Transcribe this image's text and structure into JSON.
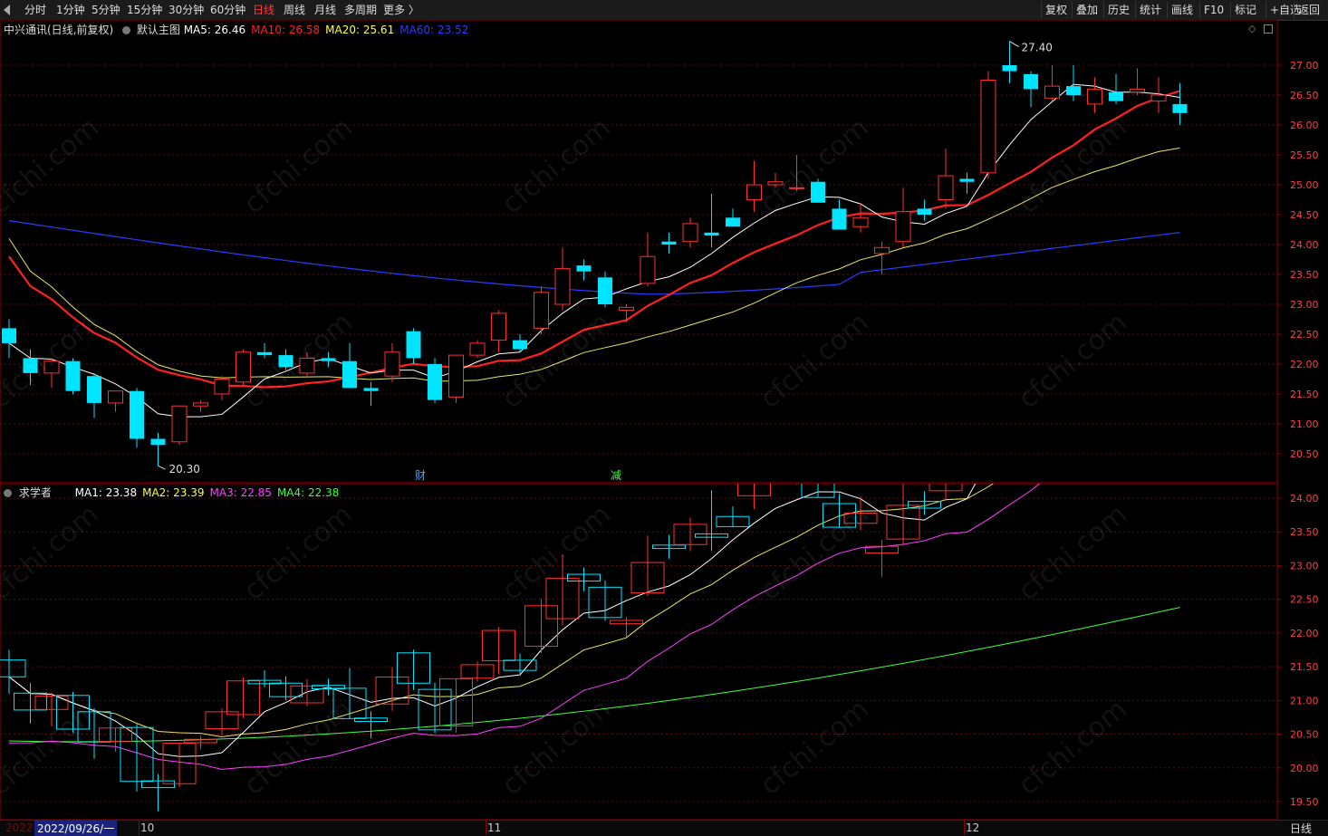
{
  "toolbar": {
    "left_items": [
      "分时",
      "1分钟",
      "5分钟",
      "15分钟",
      "30分钟",
      "60分钟",
      "日线",
      "周线",
      "月线",
      "多周期",
      "更多 〉"
    ],
    "active": "日线",
    "right_items": [
      "复权",
      "叠加",
      "历史",
      "统计",
      "画线",
      "F10",
      "标记",
      "+自选",
      "返回"
    ]
  },
  "main_panel": {
    "title": "中兴通讯(日线,前复权)",
    "indicator_name": "默认主图",
    "ma_labels": [
      {
        "text": "MA5: 26.46",
        "color": "#ffffff"
      },
      {
        "text": "MA10: 26.58",
        "color": "#ff2020"
      },
      {
        "text": "MA20: 25.61",
        "color": "#ffff40"
      },
      {
        "text": "MA60: 23.52",
        "color": "#2a3cff"
      }
    ],
    "y_ticks": [
      "27.00",
      "26.50",
      "26.00",
      "25.50",
      "25.00",
      "24.50",
      "24.00",
      "23.50",
      "23.00",
      "22.50",
      "22.00",
      "21.50",
      "21.00",
      "20.50"
    ],
    "high_label": "27.40",
    "low_label": "20.30",
    "markers": [
      {
        "text": "财",
        "color": "#4fa3ff"
      },
      {
        "text": "减",
        "color": "#40ff40"
      }
    ]
  },
  "sub_panel": {
    "indicator_name": "求学者",
    "ma_labels": [
      {
        "text": "MA1: 23.38",
        "color": "#ffffff"
      },
      {
        "text": "MA2: 23.39",
        "color": "#ffff40"
      },
      {
        "text": "MA3: 22.85",
        "color": "#ff40ff"
      },
      {
        "text": "MA4: 22.38",
        "color": "#40ff40"
      }
    ],
    "y_ticks": [
      "24.00",
      "23.50",
      "23.00",
      "22.50",
      "22.00",
      "21.50",
      "21.00",
      "20.50",
      "20.00",
      "19.50"
    ]
  },
  "bottom": {
    "year": "2022",
    "cursor_date": "2022/09/26/一",
    "months": [
      "10",
      "11",
      "12"
    ],
    "period": "日线"
  },
  "watermark": "cfchi.com",
  "chart_data": {
    "type": "candlestick",
    "ohlc": [
      [
        22.6,
        22.75,
        22.1,
        22.35
      ],
      [
        22.1,
        22.25,
        21.65,
        21.85
      ],
      [
        21.85,
        22.1,
        21.6,
        22.05
      ],
      [
        22.05,
        22.1,
        21.5,
        21.55
      ],
      [
        21.8,
        21.85,
        21.1,
        21.35
      ],
      [
        21.35,
        21.55,
        21.2,
        21.55
      ],
      [
        21.55,
        21.6,
        20.6,
        20.75
      ],
      [
        20.75,
        20.85,
        20.3,
        20.65
      ],
      [
        20.7,
        21.3,
        20.65,
        21.3
      ],
      [
        21.3,
        21.4,
        21.2,
        21.35
      ],
      [
        21.5,
        21.8,
        21.4,
        21.75
      ],
      [
        21.7,
        22.25,
        21.65,
        22.2
      ],
      [
        22.2,
        22.35,
        22.1,
        22.15
      ],
      [
        22.15,
        22.25,
        21.9,
        21.95
      ],
      [
        21.85,
        22.2,
        21.8,
        22.1
      ],
      [
        22.1,
        22.2,
        21.95,
        22.05
      ],
      [
        22.05,
        22.35,
        21.6,
        21.6
      ],
      [
        21.6,
        21.7,
        21.3,
        21.55
      ],
      [
        21.8,
        22.35,
        21.7,
        22.2
      ],
      [
        22.55,
        22.6,
        22.0,
        22.1
      ],
      [
        22.0,
        22.1,
        21.35,
        21.4
      ],
      [
        21.45,
        22.15,
        21.35,
        22.15
      ],
      [
        22.15,
        22.4,
        22.1,
        22.35
      ],
      [
        22.4,
        22.9,
        22.2,
        22.85
      ],
      [
        22.4,
        22.5,
        22.2,
        22.25
      ],
      [
        22.6,
        23.3,
        22.5,
        23.2
      ],
      [
        23.0,
        23.95,
        22.9,
        23.6
      ],
      [
        23.65,
        23.75,
        23.4,
        23.55
      ],
      [
        23.45,
        23.55,
        22.95,
        23.0
      ],
      [
        22.9,
        23.0,
        22.7,
        22.95
      ],
      [
        23.35,
        24.2,
        23.3,
        23.8
      ],
      [
        24.05,
        24.2,
        23.85,
        24.0
      ],
      [
        24.05,
        24.45,
        23.95,
        24.35
      ],
      [
        24.2,
        24.85,
        23.95,
        24.15
      ],
      [
        24.45,
        24.6,
        24.3,
        24.3
      ],
      [
        24.75,
        25.4,
        24.55,
        25.0
      ],
      [
        25.0,
        25.2,
        24.95,
        25.05
      ],
      [
        24.95,
        25.5,
        24.9,
        24.95
      ],
      [
        25.05,
        25.1,
        24.7,
        24.7
      ],
      [
        24.6,
        24.75,
        24.25,
        24.25
      ],
      [
        24.3,
        24.7,
        24.2,
        24.45
      ],
      [
        23.85,
        24.05,
        23.5,
        23.95
      ],
      [
        24.05,
        24.95,
        23.95,
        24.55
      ],
      [
        24.6,
        24.75,
        24.4,
        24.5
      ],
      [
        24.75,
        25.6,
        24.6,
        25.15
      ],
      [
        25.1,
        25.2,
        24.85,
        25.05
      ],
      [
        25.2,
        26.9,
        25.1,
        26.75
      ],
      [
        27.0,
        27.4,
        26.7,
        26.9
      ],
      [
        26.85,
        26.9,
        26.3,
        26.6
      ],
      [
        26.45,
        27.0,
        26.4,
        26.65
      ],
      [
        26.65,
        27.0,
        26.4,
        26.5
      ],
      [
        26.35,
        26.8,
        26.2,
        26.6
      ],
      [
        26.55,
        26.85,
        26.35,
        26.4
      ],
      [
        26.55,
        26.95,
        26.5,
        26.6
      ],
      [
        26.4,
        26.8,
        26.2,
        26.5
      ],
      [
        26.35,
        26.7,
        26.0,
        26.2
      ]
    ],
    "ma5_last": 26.46,
    "ma10_last": 26.58,
    "ma20_last": 25.61,
    "ma60_last": 23.52,
    "sub_last": {
      "MA1": 23.38,
      "MA2": 23.39,
      "MA3": 22.85,
      "MA4": 22.38
    }
  }
}
